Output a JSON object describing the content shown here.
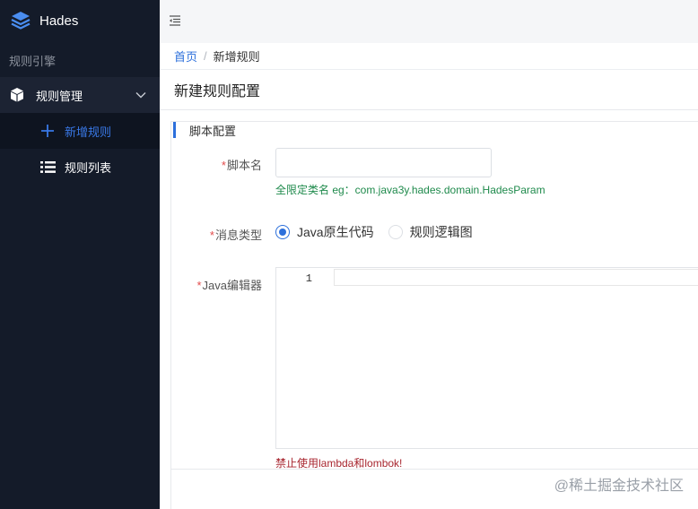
{
  "app": {
    "name": "Hades"
  },
  "sidebar": {
    "section_label": "规则引擎",
    "group": {
      "label": "规则管理"
    },
    "items": [
      {
        "label": "新增规则",
        "icon": "plus-icon",
        "active": true
      },
      {
        "label": "规则列表",
        "icon": "list-icon",
        "active": false
      }
    ]
  },
  "breadcrumb": {
    "home": "首页",
    "separator": "/",
    "current": "新增规则"
  },
  "page": {
    "title": "新建规则配置"
  },
  "form": {
    "section_title": "脚本配置",
    "script_name": {
      "required_mark": "*",
      "label": "脚本名",
      "value": "",
      "placeholder": ""
    },
    "script_hint": "全限定类名 eg：com.java3y.hades.domain.HadesParam",
    "message_type": {
      "required_mark": "*",
      "label": "消息类型",
      "options": [
        {
          "label": "Java原生代码",
          "checked": true
        },
        {
          "label": "规则逻辑图",
          "checked": false
        }
      ]
    },
    "editor": {
      "required_mark": "*",
      "label": "Java编辑器",
      "line_number": "1"
    },
    "editor_hint": "禁止使用lambda和lombok!"
  },
  "watermark": "@稀土掘金技术社区",
  "colors": {
    "sidebar_bg": "#141b29",
    "accent": "#2c6fdb",
    "hint_green": "#1f8a4c",
    "hint_red": "#a8262f"
  }
}
